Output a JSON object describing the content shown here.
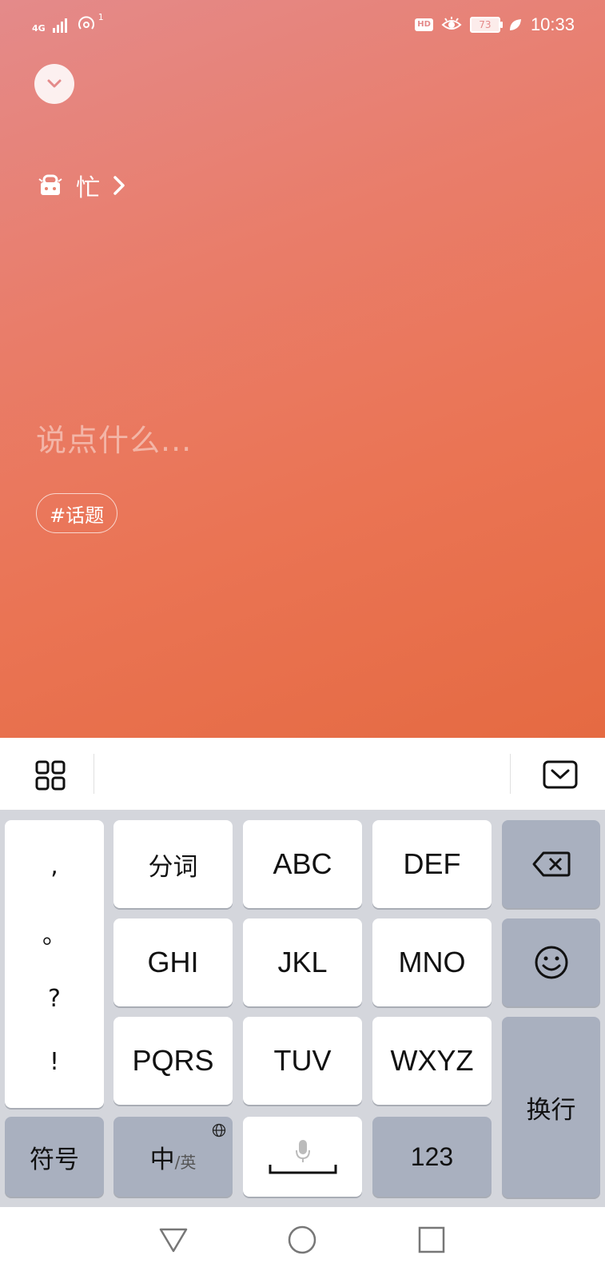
{
  "status_bar": {
    "network": "4G",
    "sim_index": "1",
    "hd_badge": "HD",
    "battery": "73",
    "time": "10:33"
  },
  "mood": {
    "label": "忙"
  },
  "compose": {
    "placeholder": "说点什么...",
    "topic_button": "#话题"
  },
  "keyboard": {
    "punctuation": [
      ",",
      "。",
      "?",
      "!"
    ],
    "row1": [
      "分词",
      "ABC",
      "DEF"
    ],
    "row2": [
      "GHI",
      "JKL",
      "MNO"
    ],
    "row3": [
      "PQRS",
      "TUV",
      "WXYZ"
    ],
    "symbols": "符号",
    "lang_main": "中",
    "lang_sub": "/英",
    "numbers": "123",
    "enter": "换行"
  },
  "icons": [
    "chevron-down-icon",
    "busy-icon",
    "chevron-right-icon",
    "grid-icon",
    "hide-keyboard-icon",
    "backspace-icon",
    "emoji-icon",
    "globe-icon",
    "microphone-icon",
    "back-icon",
    "home-icon",
    "recents-icon"
  ],
  "colors": {
    "accent_start": "#e48a8a",
    "accent_end": "#e56a42",
    "keyboard_bg": "#d4d6dc",
    "function_key": "#a9b0bf"
  }
}
